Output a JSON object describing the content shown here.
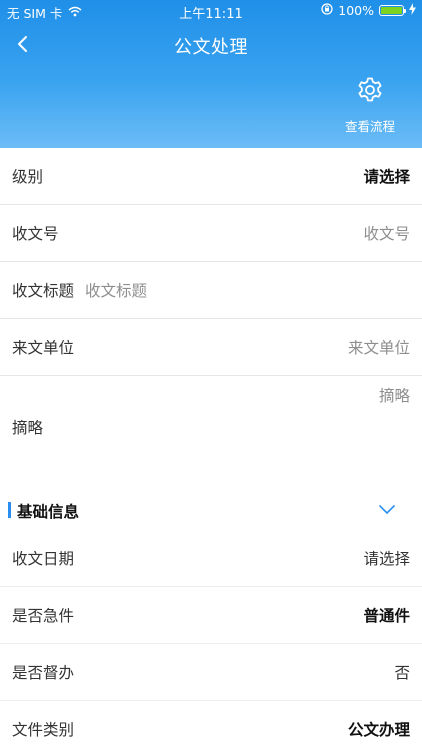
{
  "status_bar": {
    "carrier": "无 SIM 卡",
    "time": "上午11:11",
    "battery": "100%",
    "battery_level": 1.0,
    "icons": [
      "wifi-icon",
      "orientation-lock-icon",
      "battery-icon",
      "charging-icon"
    ]
  },
  "nav": {
    "title": "公文处理",
    "back_icon": "chevron-left-icon",
    "flow_label": "查看流程",
    "flow_icon": "gear-icon"
  },
  "form": {
    "level": {
      "label": "级别",
      "value": "请选择"
    },
    "receive_number": {
      "label": "收文号",
      "placeholder": "收文号"
    },
    "receive_title": {
      "label": "收文标题",
      "placeholder": "收文标题"
    },
    "sender_unit": {
      "label": "来文单位",
      "placeholder": "来文单位"
    },
    "abstract": {
      "label": "摘略",
      "placeholder": "摘略"
    }
  },
  "basic_info": {
    "title": "基础信息",
    "toggle_icon": "chevron-down-icon",
    "receive_date": {
      "label": "收文日期",
      "value": "请选择"
    },
    "urgent": {
      "label": "是否急件",
      "value": "普通件"
    },
    "supervise": {
      "label": "是否督办",
      "value": "否"
    },
    "doc_type": {
      "label": "文件类别",
      "value": "公文办理"
    }
  },
  "colors": {
    "header_top": "#1f8fe8",
    "header_bottom": "#6cbcf6",
    "accent": "#2a8ef0",
    "battery": "#7ed321"
  }
}
